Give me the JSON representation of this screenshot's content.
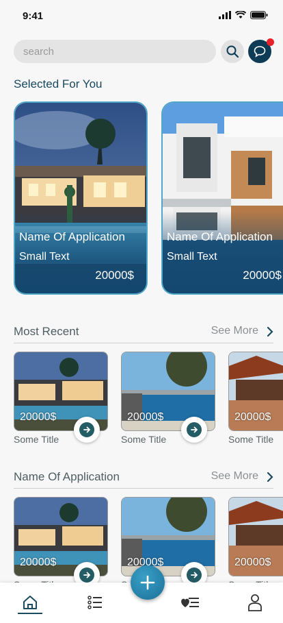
{
  "status": {
    "time": "9:41"
  },
  "search": {
    "placeholder": "search"
  },
  "selected_section": {
    "title": "Selected For You",
    "cards": [
      {
        "name": "Name Of Application",
        "small": "Small Text",
        "price": "20000$"
      },
      {
        "name": "Name Of Application",
        "small": "Small Text",
        "price": "20000$"
      }
    ]
  },
  "recent_section": {
    "title": "Most Recent",
    "see_more": "See More",
    "items": [
      {
        "price": "20000$",
        "title": "Some Title"
      },
      {
        "price": "20000$",
        "title": "Some Title"
      },
      {
        "price": "20000$",
        "title": "Some Title"
      }
    ]
  },
  "app_section": {
    "title": "Name Of Application",
    "see_more": "See More",
    "items": [
      {
        "price": "20000$",
        "title": "Some Title"
      },
      {
        "price": "20000$",
        "title": "Some Title"
      },
      {
        "price": "20000$",
        "title": "Some Title"
      }
    ]
  },
  "nav": {
    "items": [
      "home-icon",
      "list-icon",
      "add-icon",
      "favorites-list-icon",
      "profile-icon"
    ],
    "active": "home-icon"
  },
  "colors": {
    "primary": "#0e3b55",
    "accent": "#2b8db5",
    "notification": "#e8222a"
  }
}
